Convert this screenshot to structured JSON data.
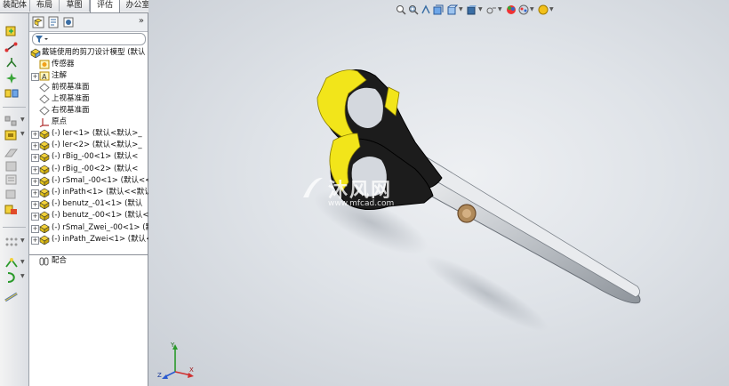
{
  "tabs": [
    "装配体",
    "布局",
    "草图",
    "评估",
    "办公室产品"
  ],
  "active_tab": "评估",
  "feature_manager": {
    "expand_glyph": "»",
    "filter_icon": "filter-icon",
    "root": {
      "label": "戴链使用的剪刀设计模型  (默认"
    },
    "items": [
      {
        "label": "传感器",
        "icon": "sensor-icon",
        "expander": false
      },
      {
        "label": "注解",
        "icon": "annotation-icon",
        "expander": true
      },
      {
        "label": "前视基准面",
        "icon": "plane-icon",
        "expander": false
      },
      {
        "label": "上视基准面",
        "icon": "plane-icon",
        "expander": false
      },
      {
        "label": "右视基准面",
        "icon": "plane-icon",
        "expander": false
      },
      {
        "label": "原点",
        "icon": "origin-icon",
        "expander": false
      },
      {
        "label": "(-) ler<1> (默认<默认>_",
        "icon": "part-icon",
        "expander": true
      },
      {
        "label": "(-) ler<2> (默认<默认>_",
        "icon": "part-icon",
        "expander": true
      },
      {
        "label": "(-) rBig_-00<1> (默认<",
        "icon": "part-icon",
        "expander": true
      },
      {
        "label": "(-) rBig_-00<2> (默认<",
        "icon": "part-icon",
        "expander": true
      },
      {
        "label": "(-) rSmal_-00<1> (默认<<",
        "icon": "part-icon",
        "expander": true
      },
      {
        "label": "(-) inPath<1> (默认<<默认",
        "icon": "part-icon",
        "expander": true
      },
      {
        "label": "(-) benutz_-01<1> (默认",
        "icon": "part-icon",
        "expander": true
      },
      {
        "label": "(-) benutz_-00<1> (默认<",
        "icon": "part-icon",
        "expander": true
      },
      {
        "label": "(-) rSmal_Zwei_-00<1> (默",
        "icon": "part-icon",
        "expander": true
      },
      {
        "label": "(-) inPath_Zwei<1> (默认<",
        "icon": "part-icon",
        "expander": true
      },
      {
        "label": "配合",
        "icon": "mate-icon",
        "expander": false
      }
    ]
  },
  "watermark": {
    "text": "沐风网",
    "url": "www.mfcad.com"
  },
  "triad": {
    "x": "X",
    "y": "Y",
    "z": "Z"
  },
  "colors": {
    "handle_yellow": "#f2e51a",
    "handle_black": "#1c1c1c",
    "blade": "#c9ccd0",
    "accent": "#3a6ea5"
  }
}
